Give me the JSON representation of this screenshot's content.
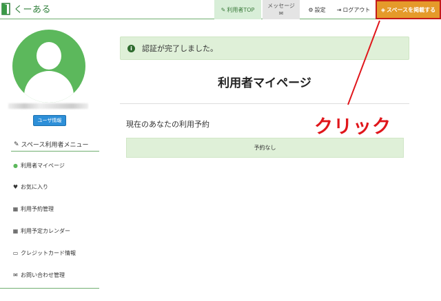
{
  "header": {
    "logo_text": "くーある",
    "nav_top": "利用者TOP",
    "nav_messages": "メッセージ",
    "nav_settings": "設定",
    "nav_logout": "ログアウト",
    "nav_post_space": "スペースを掲載する"
  },
  "sidebar": {
    "user_info_button": "ユーザ情報",
    "menu_heading": "スペース利用者メニュー",
    "items": [
      {
        "label": "利用者マイページ",
        "icon": "user-circle-icon"
      },
      {
        "label": "お気に入り",
        "icon": "heart-icon"
      },
      {
        "label": "利用予約管理",
        "icon": "calendar-icon"
      },
      {
        "label": "利用予定カレンダー",
        "icon": "calendar-icon"
      },
      {
        "label": "クレジットカード情報",
        "icon": "credit-card-icon"
      },
      {
        "label": "お問い合わせ管理",
        "icon": "envelope-icon"
      }
    ]
  },
  "main": {
    "alert_text": "認証が完了しました。",
    "page_title": "利用者マイページ",
    "section_title": "現在のあなたの利用予約",
    "reservation_empty": "予約なし"
  },
  "annotation": {
    "label": "クリック",
    "color": "#e0161b"
  },
  "colors": {
    "brand_green": "#5cb85c",
    "post_button": "#e59a2a",
    "alert_bg": "#dff0d8",
    "info_button": "#2d8fd8"
  }
}
